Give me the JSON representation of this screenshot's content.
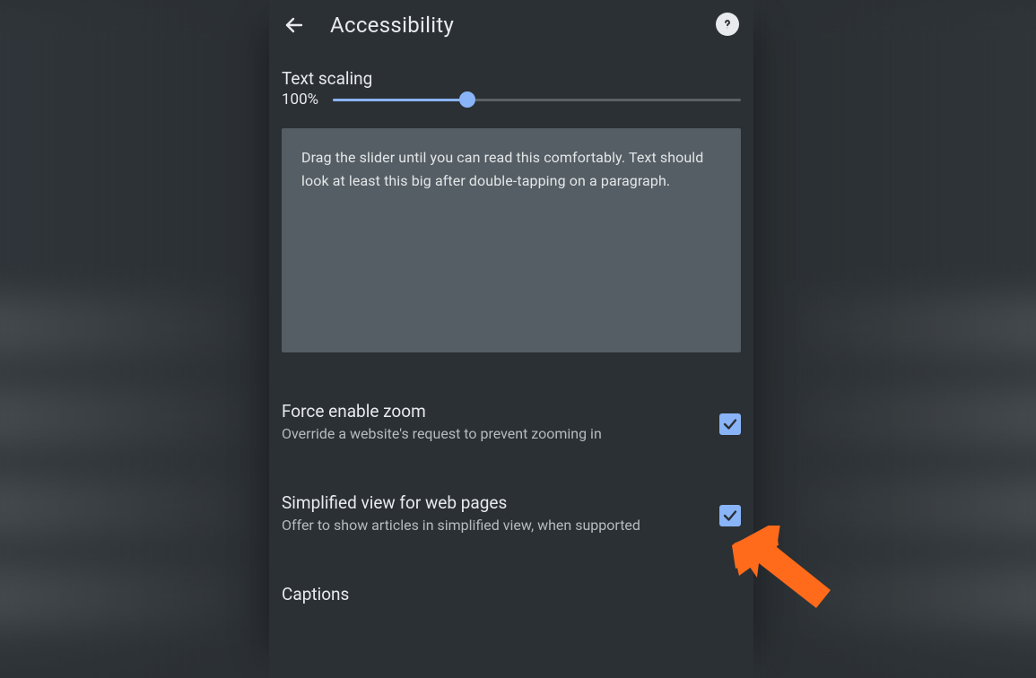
{
  "header": {
    "title": "Accessibility"
  },
  "textScaling": {
    "label": "Text scaling",
    "value": "100%",
    "sliderPercent": 33,
    "preview": "Drag the slider until you can read this comfortably. Text should look at least this big after double-tapping on a paragraph."
  },
  "settings": {
    "forceZoom": {
      "title": "Force enable zoom",
      "sub": "Override a website's request to prevent zooming in",
      "checked": true
    },
    "simplifiedView": {
      "title": "Simplified view for web pages",
      "sub": "Offer to show articles in simplified view, when supported",
      "checked": true
    },
    "captions": {
      "title": "Captions"
    }
  },
  "colors": {
    "accent": "#8ab4f8",
    "panelBg": "#2b3034",
    "previewBg": "#555e64",
    "arrow": "#ff6b1a"
  }
}
